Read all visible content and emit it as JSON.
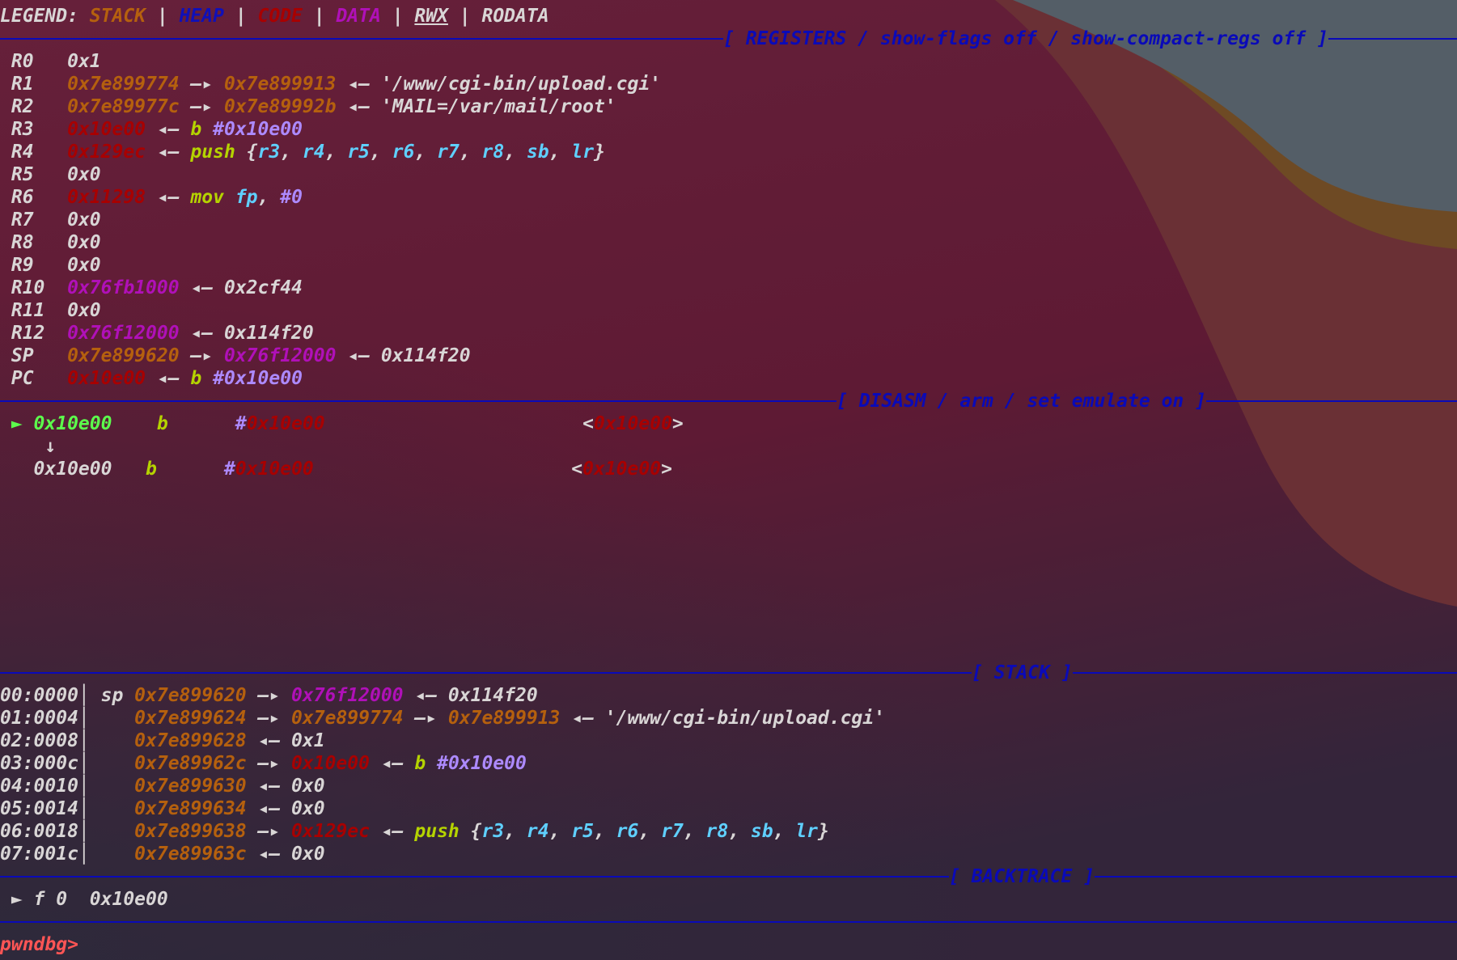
{
  "colors": {
    "w": "#d9d6d6",
    "stack": "#b5600e",
    "heap": "#1010b8",
    "code": "#a80000",
    "data": "#b010b8",
    "ins": "#b5d300",
    "reg": "#5fd0ff",
    "imm": "#ad8aff",
    "cur": "#5cff4c",
    "prompt": "#ff5555",
    "header": "#0a0ab8"
  },
  "lines": [
    {
      "kind": "legend",
      "segs": [
        {
          "t": "LEGEND: ",
          "c": "w"
        },
        {
          "t": "STACK",
          "c": "stack"
        },
        {
          "t": " | ",
          "c": "w"
        },
        {
          "t": "HEAP",
          "c": "heap"
        },
        {
          "t": " | ",
          "c": "w"
        },
        {
          "t": "CODE",
          "c": "code"
        },
        {
          "t": " | ",
          "c": "w"
        },
        {
          "t": "DATA",
          "c": "data"
        },
        {
          "t": " | ",
          "c": "w"
        },
        {
          "t": "RWX",
          "c": "w",
          "u": true
        },
        {
          "t": " | ",
          "c": "w"
        },
        {
          "t": "RODATA",
          "c": "w"
        }
      ]
    },
    {
      "kind": "header",
      "id": "registers",
      "title": "[ REGISTERS / show-flags off / show-compact-regs off ]"
    },
    {
      "kind": "reg",
      "segs": [
        {
          "t": " R0   ",
          "c": "w"
        },
        {
          "t": "0x1",
          "c": "w"
        }
      ]
    },
    {
      "kind": "reg",
      "segs": [
        {
          "t": " R1   ",
          "c": "w"
        },
        {
          "t": "0x7e899774",
          "c": "stack"
        },
        {
          "t": " —▸ ",
          "c": "w"
        },
        {
          "t": "0x7e899913",
          "c": "stack"
        },
        {
          "t": " ◂— ",
          "c": "w"
        },
        {
          "t": "'/www/cgi-bin/upload.cgi'",
          "c": "w"
        }
      ]
    },
    {
      "kind": "reg",
      "segs": [
        {
          "t": " R2   ",
          "c": "w"
        },
        {
          "t": "0x7e89977c",
          "c": "stack"
        },
        {
          "t": " —▸ ",
          "c": "w"
        },
        {
          "t": "0x7e89992b",
          "c": "stack"
        },
        {
          "t": " ◂— ",
          "c": "w"
        },
        {
          "t": "'MAIL=/var/mail/root'",
          "c": "w"
        }
      ]
    },
    {
      "kind": "reg",
      "segs": [
        {
          "t": " R3   ",
          "c": "w"
        },
        {
          "t": "0x10e00",
          "c": "code"
        },
        {
          "t": " ◂— ",
          "c": "w"
        },
        {
          "t": "b",
          "c": "ins"
        },
        {
          "t": " ",
          "c": "w"
        },
        {
          "t": "#0x10e00",
          "c": "imm"
        }
      ]
    },
    {
      "kind": "reg",
      "segs": [
        {
          "t": " R4   ",
          "c": "w"
        },
        {
          "t": "0x129ec",
          "c": "code"
        },
        {
          "t": " ◂— ",
          "c": "w"
        },
        {
          "t": "push",
          "c": "ins"
        },
        {
          "t": " {",
          "c": "w"
        },
        {
          "t": "r3",
          "c": "reg"
        },
        {
          "t": ", ",
          "c": "w"
        },
        {
          "t": "r4",
          "c": "reg"
        },
        {
          "t": ", ",
          "c": "w"
        },
        {
          "t": "r5",
          "c": "reg"
        },
        {
          "t": ", ",
          "c": "w"
        },
        {
          "t": "r6",
          "c": "reg"
        },
        {
          "t": ", ",
          "c": "w"
        },
        {
          "t": "r7",
          "c": "reg"
        },
        {
          "t": ", ",
          "c": "w"
        },
        {
          "t": "r8",
          "c": "reg"
        },
        {
          "t": ", ",
          "c": "w"
        },
        {
          "t": "sb",
          "c": "reg"
        },
        {
          "t": ", ",
          "c": "w"
        },
        {
          "t": "lr",
          "c": "reg"
        },
        {
          "t": "}",
          "c": "w"
        }
      ]
    },
    {
      "kind": "reg",
      "segs": [
        {
          "t": " R5   ",
          "c": "w"
        },
        {
          "t": "0x0",
          "c": "w"
        }
      ]
    },
    {
      "kind": "reg",
      "segs": [
        {
          "t": " R6   ",
          "c": "w"
        },
        {
          "t": "0x11298",
          "c": "code"
        },
        {
          "t": " ◂— ",
          "c": "w"
        },
        {
          "t": "mov",
          "c": "ins"
        },
        {
          "t": " ",
          "c": "w"
        },
        {
          "t": "fp",
          "c": "reg"
        },
        {
          "t": ", ",
          "c": "w"
        },
        {
          "t": "#0",
          "c": "imm"
        }
      ]
    },
    {
      "kind": "reg",
      "segs": [
        {
          "t": " R7   ",
          "c": "w"
        },
        {
          "t": "0x0",
          "c": "w"
        }
      ]
    },
    {
      "kind": "reg",
      "segs": [
        {
          "t": " R8   ",
          "c": "w"
        },
        {
          "t": "0x0",
          "c": "w"
        }
      ]
    },
    {
      "kind": "reg",
      "segs": [
        {
          "t": " R9   ",
          "c": "w"
        },
        {
          "t": "0x0",
          "c": "w"
        }
      ]
    },
    {
      "kind": "reg",
      "segs": [
        {
          "t": " R10  ",
          "c": "w"
        },
        {
          "t": "0x76fb1000",
          "c": "data"
        },
        {
          "t": " ◂— ",
          "c": "w"
        },
        {
          "t": "0x2cf44",
          "c": "w"
        }
      ]
    },
    {
      "kind": "reg",
      "segs": [
        {
          "t": " R11  ",
          "c": "w"
        },
        {
          "t": "0x0",
          "c": "w"
        }
      ]
    },
    {
      "kind": "reg",
      "segs": [
        {
          "t": " R12  ",
          "c": "w"
        },
        {
          "t": "0x76f12000",
          "c": "data"
        },
        {
          "t": " ◂— ",
          "c": "w"
        },
        {
          "t": "0x114f20",
          "c": "w"
        }
      ]
    },
    {
      "kind": "reg",
      "segs": [
        {
          "t": " SP   ",
          "c": "w"
        },
        {
          "t": "0x7e899620",
          "c": "stack"
        },
        {
          "t": " —▸ ",
          "c": "w"
        },
        {
          "t": "0x76f12000",
          "c": "data"
        },
        {
          "t": " ◂— ",
          "c": "w"
        },
        {
          "t": "0x114f20",
          "c": "w"
        }
      ]
    },
    {
      "kind": "reg",
      "segs": [
        {
          "t": " PC   ",
          "c": "w"
        },
        {
          "t": "0x10e00",
          "c": "code"
        },
        {
          "t": " ◂— ",
          "c": "w"
        },
        {
          "t": "b",
          "c": "ins"
        },
        {
          "t": " ",
          "c": "w"
        },
        {
          "t": "#0x10e00",
          "c": "imm"
        }
      ]
    },
    {
      "kind": "header",
      "id": "disasm",
      "title": "[ DISASM / arm / set emulate on ]"
    },
    {
      "kind": "disasm",
      "segs": [
        {
          "t": " ► ",
          "c": "cur"
        },
        {
          "t": "0x10e00",
          "c": "cur"
        },
        {
          "t": "    ",
          "c": "w"
        },
        {
          "t": "b",
          "c": "ins"
        },
        {
          "t": "      ",
          "c": "w"
        },
        {
          "t": "#",
          "c": "imm"
        },
        {
          "t": "0x10e00",
          "c": "code"
        },
        {
          "t": "                       ",
          "c": "w"
        },
        {
          "t": "<",
          "c": "w"
        },
        {
          "t": "0x10e00",
          "c": "code"
        },
        {
          "t": ">",
          "c": "w"
        }
      ]
    },
    {
      "kind": "disasm",
      "segs": [
        {
          "t": "    ↓",
          "c": "w"
        }
      ]
    },
    {
      "kind": "disasm",
      "segs": [
        {
          "t": "   ",
          "c": "w"
        },
        {
          "t": "0x10e00",
          "c": "w"
        },
        {
          "t": "   ",
          "c": "w"
        },
        {
          "t": "b",
          "c": "ins"
        },
        {
          "t": "      ",
          "c": "w"
        },
        {
          "t": "#",
          "c": "imm"
        },
        {
          "t": "0x10e00",
          "c": "code"
        },
        {
          "t": "                       ",
          "c": "w"
        },
        {
          "t": "<",
          "c": "w"
        },
        {
          "t": "0x10e00",
          "c": "code"
        },
        {
          "t": ">",
          "c": "w"
        }
      ]
    },
    {
      "kind": "blank"
    },
    {
      "kind": "blank"
    },
    {
      "kind": "blank"
    },
    {
      "kind": "blank"
    },
    {
      "kind": "blank"
    },
    {
      "kind": "blank"
    },
    {
      "kind": "blank"
    },
    {
      "kind": "blank"
    },
    {
      "kind": "header",
      "id": "stack",
      "title": "[ STACK ]"
    },
    {
      "kind": "stack",
      "segs": [
        {
          "t": "00:0000│ sp ",
          "c": "w"
        },
        {
          "t": "0x7e899620",
          "c": "stack"
        },
        {
          "t": " —▸ ",
          "c": "w"
        },
        {
          "t": "0x76f12000",
          "c": "data"
        },
        {
          "t": " ◂— ",
          "c": "w"
        },
        {
          "t": "0x114f20",
          "c": "w"
        }
      ]
    },
    {
      "kind": "stack",
      "segs": [
        {
          "t": "01:0004│    ",
          "c": "w"
        },
        {
          "t": "0x7e899624",
          "c": "stack"
        },
        {
          "t": " —▸ ",
          "c": "w"
        },
        {
          "t": "0x7e899774",
          "c": "stack"
        },
        {
          "t": " —▸ ",
          "c": "w"
        },
        {
          "t": "0x7e899913",
          "c": "stack"
        },
        {
          "t": " ◂— ",
          "c": "w"
        },
        {
          "t": "'/www/cgi-bin/upload.cgi'",
          "c": "w"
        }
      ]
    },
    {
      "kind": "stack",
      "segs": [
        {
          "t": "02:0008│    ",
          "c": "w"
        },
        {
          "t": "0x7e899628",
          "c": "stack"
        },
        {
          "t": " ◂— ",
          "c": "w"
        },
        {
          "t": "0x1",
          "c": "w"
        }
      ]
    },
    {
      "kind": "stack",
      "segs": [
        {
          "t": "03:000c│    ",
          "c": "w"
        },
        {
          "t": "0x7e89962c",
          "c": "stack"
        },
        {
          "t": " —▸ ",
          "c": "w"
        },
        {
          "t": "0x10e00",
          "c": "code"
        },
        {
          "t": " ◂— ",
          "c": "w"
        },
        {
          "t": "b",
          "c": "ins"
        },
        {
          "t": " ",
          "c": "w"
        },
        {
          "t": "#0x10e00",
          "c": "imm"
        }
      ]
    },
    {
      "kind": "stack",
      "segs": [
        {
          "t": "04:0010│    ",
          "c": "w"
        },
        {
          "t": "0x7e899630",
          "c": "stack"
        },
        {
          "t": " ◂— ",
          "c": "w"
        },
        {
          "t": "0x0",
          "c": "w"
        }
      ]
    },
    {
      "kind": "stack",
      "segs": [
        {
          "t": "05:0014│    ",
          "c": "w"
        },
        {
          "t": "0x7e899634",
          "c": "stack"
        },
        {
          "t": " ◂— ",
          "c": "w"
        },
        {
          "t": "0x0",
          "c": "w"
        }
      ]
    },
    {
      "kind": "stack",
      "segs": [
        {
          "t": "06:0018│    ",
          "c": "w"
        },
        {
          "t": "0x7e899638",
          "c": "stack"
        },
        {
          "t": " —▸ ",
          "c": "w"
        },
        {
          "t": "0x129ec",
          "c": "code"
        },
        {
          "t": " ◂— ",
          "c": "w"
        },
        {
          "t": "push",
          "c": "ins"
        },
        {
          "t": " {",
          "c": "w"
        },
        {
          "t": "r3",
          "c": "reg"
        },
        {
          "t": ", ",
          "c": "w"
        },
        {
          "t": "r4",
          "c": "reg"
        },
        {
          "t": ", ",
          "c": "w"
        },
        {
          "t": "r5",
          "c": "reg"
        },
        {
          "t": ", ",
          "c": "w"
        },
        {
          "t": "r6",
          "c": "reg"
        },
        {
          "t": ", ",
          "c": "w"
        },
        {
          "t": "r7",
          "c": "reg"
        },
        {
          "t": ", ",
          "c": "w"
        },
        {
          "t": "r8",
          "c": "reg"
        },
        {
          "t": ", ",
          "c": "w"
        },
        {
          "t": "sb",
          "c": "reg"
        },
        {
          "t": ", ",
          "c": "w"
        },
        {
          "t": "lr",
          "c": "reg"
        },
        {
          "t": "}",
          "c": "w"
        }
      ]
    },
    {
      "kind": "stack",
      "segs": [
        {
          "t": "07:001c│    ",
          "c": "w"
        },
        {
          "t": "0x7e89963c",
          "c": "stack"
        },
        {
          "t": " ◂— ",
          "c": "w"
        },
        {
          "t": "0x0",
          "c": "w"
        }
      ]
    },
    {
      "kind": "header",
      "id": "backtrace",
      "title": "[ BACKTRACE ]"
    },
    {
      "kind": "backtrace",
      "segs": [
        {
          "t": " ► f 0  0x10e00",
          "c": "w"
        }
      ]
    },
    {
      "kind": "header",
      "id": "end",
      "title": ""
    },
    {
      "kind": "prompt",
      "segs": [
        {
          "t": "pwndbg>",
          "c": "prompt"
        }
      ]
    }
  ]
}
